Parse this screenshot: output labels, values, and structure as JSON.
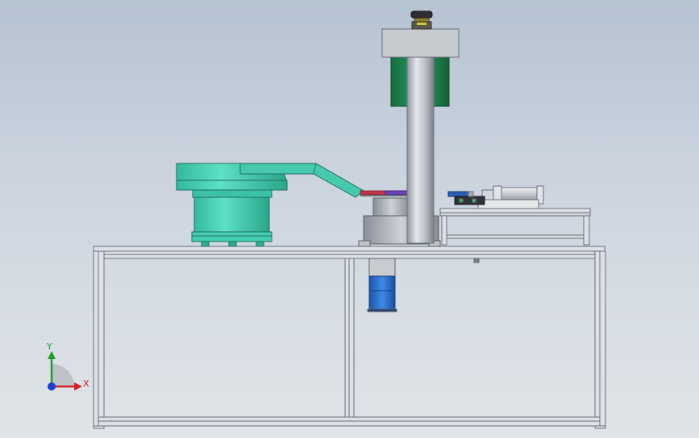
{
  "viewport": {
    "background_top": "#b6c3d2",
    "background_bottom": "#e0e4e8"
  },
  "model": {
    "name": "",
    "colors": {
      "frame_steel": "#dde1e6",
      "frame_edge": "#6b7079",
      "bowl_feeder": "#4fd3b8",
      "bowl_feeder_dark": "#2fae94",
      "column_steel": "#b9bec6",
      "housing_gray": "#c7cacf",
      "green_guard": "#1f8a52",
      "motor_blue": "#2a6fd1",
      "rail_red": "#c2334a",
      "rail_purple": "#6b43b8"
    }
  },
  "triad": {
    "x_label": "X",
    "y_label": "Y",
    "x_color": "#d42020",
    "y_color": "#1e9a2a",
    "z_color": "#1f3fd4"
  }
}
